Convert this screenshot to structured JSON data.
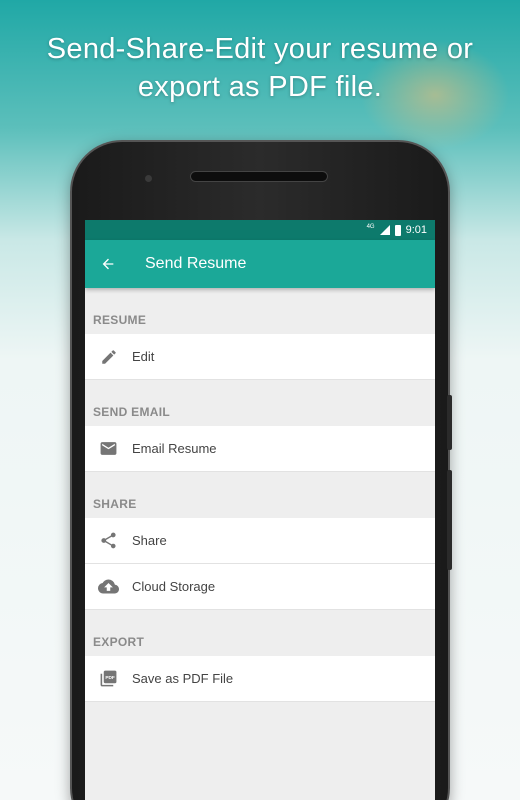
{
  "promo": {
    "line1": "Send-Share-Edit your resume or",
    "line2": "export as PDF file."
  },
  "status_bar": {
    "network": "4G",
    "time": "9:01"
  },
  "app_bar": {
    "title": "Send Resume",
    "back_icon": "arrow-back-icon",
    "color": "#1ba898"
  },
  "sections": [
    {
      "header": "RESUME",
      "items": [
        {
          "label": "Edit",
          "icon": "pencil-icon"
        }
      ]
    },
    {
      "header": "SEND EMAIL",
      "items": [
        {
          "label": "Email Resume",
          "icon": "envelope-icon"
        }
      ]
    },
    {
      "header": "SHARE",
      "items": [
        {
          "label": "Share",
          "icon": "share-icon"
        },
        {
          "label": "Cloud Storage",
          "icon": "cloud-upload-icon"
        }
      ]
    },
    {
      "header": "EXPORT",
      "items": [
        {
          "label": "Save as PDF File",
          "icon": "pdf-icon"
        }
      ]
    }
  ],
  "colors": {
    "primary": "#1ba898",
    "primary_dark": "#0d7a6c",
    "section_header_text": "#8a8a8a",
    "icon_gray": "#757575"
  }
}
